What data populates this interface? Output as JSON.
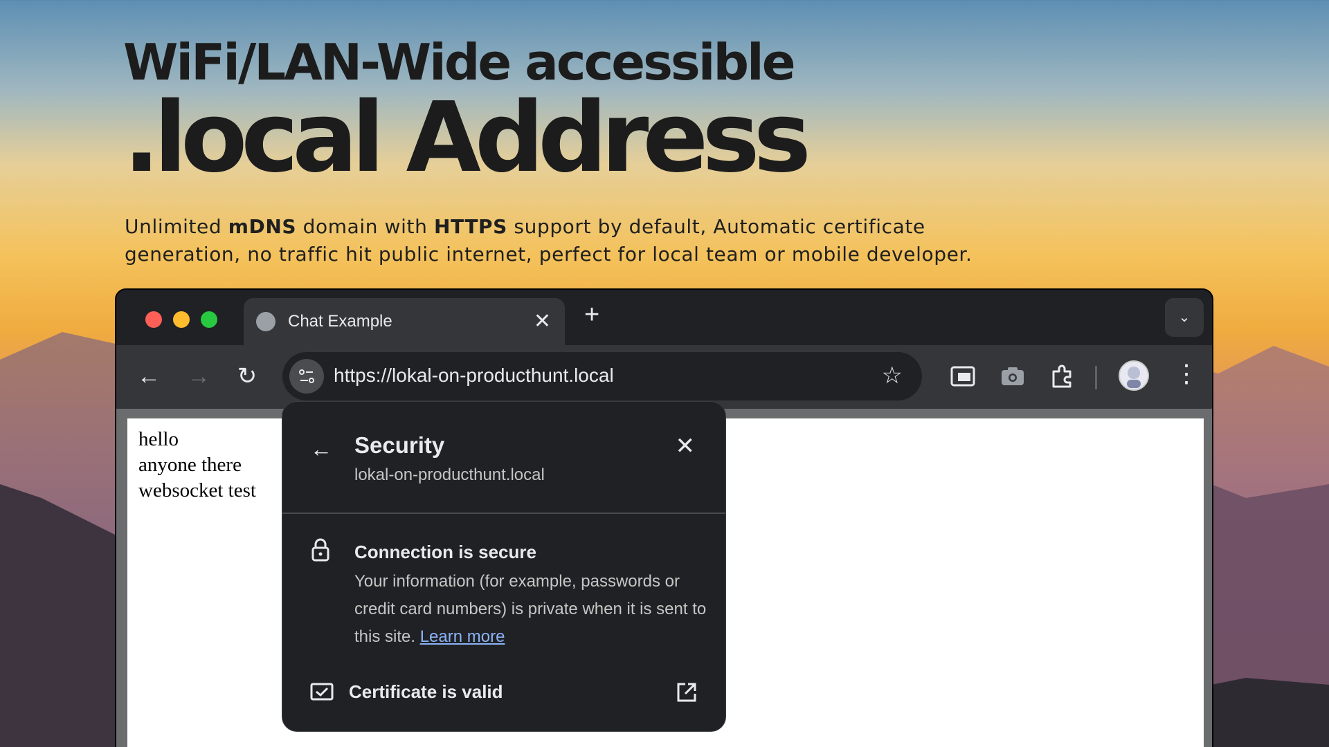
{
  "hero": {
    "line1": "WiFi/LAN-Wide accessible",
    "line2": ".local Address",
    "sub_part1": "Unlimited ",
    "sub_bold1": "mDNS",
    "sub_part2": " domain with ",
    "sub_bold2": "HTTPS",
    "sub_part3": " support by default, Automatic certificate generation, no traffic hit public internet, perfect for local team or mobile developer."
  },
  "browser": {
    "tab_title": "Chat Example",
    "tab_close": "✕",
    "new_tab": "+",
    "dropdown": "⌄",
    "url": "https://lokal-on-producthunt.local",
    "back": "←",
    "forward": "→",
    "reload": "↻",
    "bookmark": "☆",
    "kebab": "⋮"
  },
  "page": {
    "line1": "hello",
    "line2": "anyone there",
    "line3": "websocket test"
  },
  "security_popup": {
    "back": "←",
    "title": "Security",
    "domain": "lokal-on-producthunt.local",
    "close": "✕",
    "connection_title": "Connection is secure",
    "connection_body": "Your information (for example, passwords or credit card numbers) is private when it is sent to this site. ",
    "learn_more": "Learn more",
    "certificate_label": "Certificate is valid"
  },
  "colors": {
    "chrome_dark": "#202124",
    "toolbar": "#35363a",
    "link": "#8ab4f8"
  }
}
